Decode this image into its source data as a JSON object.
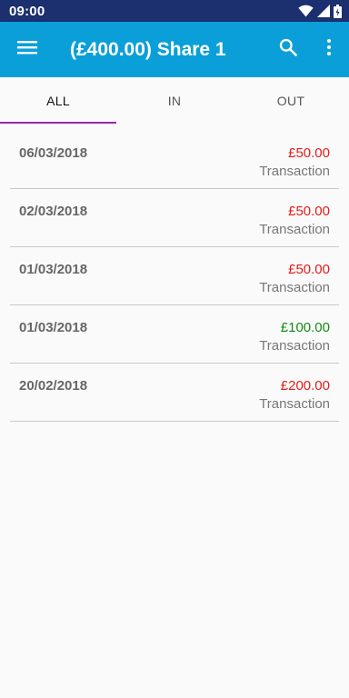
{
  "status_bar": {
    "time": "09:00"
  },
  "app_bar": {
    "title": "(£400.00) Share 1"
  },
  "tabs": [
    {
      "label": "ALL",
      "active": true
    },
    {
      "label": "IN",
      "active": false
    },
    {
      "label": "OUT",
      "active": false
    }
  ],
  "transactions": [
    {
      "date": "06/03/2018",
      "amount": "£50.00",
      "description": "Transaction",
      "direction": "out"
    },
    {
      "date": "02/03/2018",
      "amount": "£50.00",
      "description": "Transaction",
      "direction": "out"
    },
    {
      "date": "01/03/2018",
      "amount": "£50.00",
      "description": "Transaction",
      "direction": "out"
    },
    {
      "date": "01/03/2018",
      "amount": "£100.00",
      "description": "Transaction",
      "direction": "in"
    },
    {
      "date": "20/02/2018",
      "amount": "£200.00",
      "description": "Transaction",
      "direction": "out"
    }
  ],
  "colors": {
    "status_bar": "#1c2f6e",
    "app_bar": "#0b9fd9",
    "tab_indicator": "#9c27b0",
    "amount_out": "#e31b1b",
    "amount_in": "#138a13"
  },
  "icons": {
    "menu": "menu-icon",
    "search": "search-icon",
    "more": "more-vert-icon",
    "wifi": "wifi-icon",
    "signal": "signal-icon",
    "battery": "battery-icon"
  }
}
